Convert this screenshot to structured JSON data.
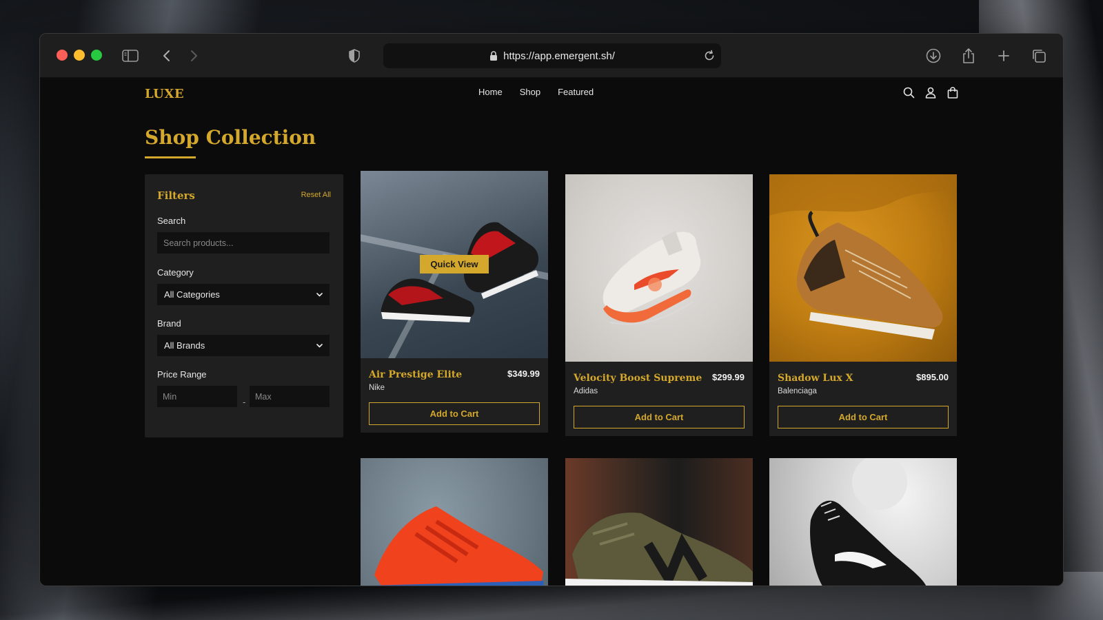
{
  "browser": {
    "url": "https://app.emergent.sh/",
    "icons": [
      "sidebar-icon",
      "back-icon",
      "forward-icon",
      "shield-icon",
      "lock-icon",
      "reload-icon",
      "download-icon",
      "share-icon",
      "new-tab-icon",
      "tabs-icon"
    ]
  },
  "nav": {
    "logo": "LUXE",
    "links": [
      "Home",
      "Shop",
      "Featured"
    ],
    "icons": [
      "search-icon",
      "user-icon",
      "bag-icon"
    ]
  },
  "page": {
    "title": "Shop Collection"
  },
  "filters": {
    "title": "Filters",
    "reset_label": "Reset All",
    "search_label": "Search",
    "search_placeholder": "Search products...",
    "category_label": "Category",
    "category_value": "All Categories",
    "brand_label": "Brand",
    "brand_value": "All Brands",
    "price_label": "Price Range",
    "price_sep": "-",
    "min_placeholder": "Min",
    "max_placeholder": "Max"
  },
  "products": [
    {
      "name": "Air Prestige Elite",
      "price": "$349.99",
      "brand": "Nike",
      "cart_label": "Add to Cart",
      "quick_view": "Quick View"
    },
    {
      "name": "Velocity Boost Supreme",
      "price": "$299.99",
      "brand": "Adidas",
      "cart_label": "Add to Cart"
    },
    {
      "name": "Shadow Lux X",
      "price": "$895.00",
      "brand": "Balenciaga",
      "cart_label": "Add to Cart"
    },
    {
      "name": "",
      "price": "",
      "brand": ""
    },
    {
      "name": "",
      "price": "",
      "brand": ""
    },
    {
      "name": "",
      "price": "",
      "brand": ""
    }
  ],
  "colors": {
    "accent": "#d4a82c",
    "background": "#0b0b0b",
    "panel": "#1f1f1f"
  }
}
